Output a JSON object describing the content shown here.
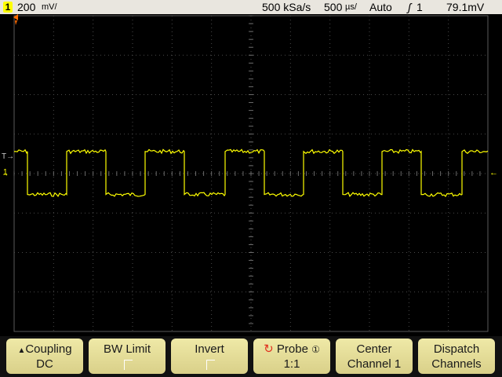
{
  "status": {
    "channel_badge": "1",
    "scale": "200",
    "scale_units": "mV/",
    "sample_rate": "500 kSa/s",
    "timebase": "500",
    "timebase_units": "µs/",
    "trigger_mode": "Auto",
    "trigger_source": "1",
    "trigger_level": "79.1mV"
  },
  "softkeys": [
    {
      "label": "Coupling",
      "value": "DC"
    },
    {
      "label": "BW Limit",
      "value": ""
    },
    {
      "label": "Invert",
      "value": ""
    },
    {
      "label": "Probe",
      "value": "1:1"
    },
    {
      "label": "Center",
      "value": "Channel 1"
    },
    {
      "label": "Dispatch",
      "value": "Channels"
    }
  ],
  "icons": {
    "coupling": "triangle-up-icon",
    "probe": "rotate-knob-icon",
    "probe_ref": "circled-1-icon",
    "trigger_edge": "rising-edge-icon"
  },
  "colors": {
    "trace": "#ffff00",
    "trigger_marker": "#ff6a00",
    "grid": "#4a4a4a",
    "softkey": "#e4dc97"
  },
  "chart_data": {
    "type": "line",
    "series": [
      {
        "shape": "square",
        "high": 0.56,
        "low": -0.53,
        "period_divisions": 2.0,
        "first_rise_division": 0.33
      }
    ],
    "xlim": [
      0,
      12
    ],
    "ylim": [
      -2,
      2
    ]
  }
}
